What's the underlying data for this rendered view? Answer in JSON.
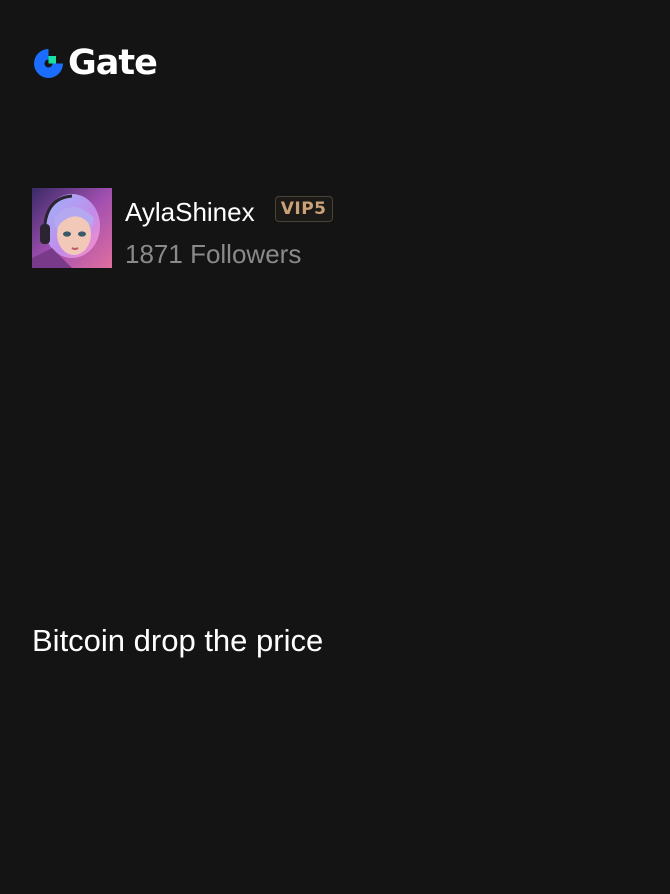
{
  "brand": {
    "name": "Gate",
    "logo_icon": "gate-logo-icon",
    "colors": {
      "mark_blue": "#1a6dff",
      "mark_green": "#17e0a0"
    }
  },
  "profile": {
    "username": "AylaShinex",
    "vip_label": "VIP5",
    "followers": "1871 Followers",
    "avatar_icon": "user-avatar"
  },
  "post": {
    "text": "Bitcoin drop the price"
  },
  "colors": {
    "background": "#141414",
    "text_primary": "#ffffff",
    "text_secondary": "#8a8a8a",
    "vip_gold": "#c9a27a"
  }
}
